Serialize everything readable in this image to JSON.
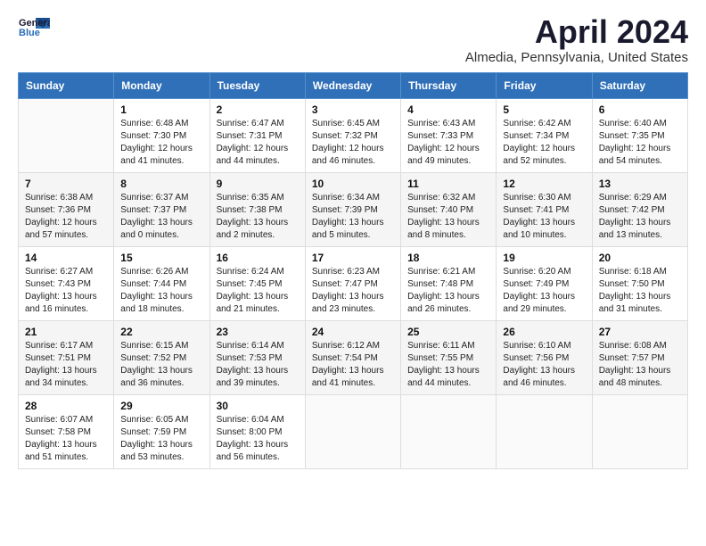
{
  "header": {
    "logo_line1": "General",
    "logo_line2": "Blue",
    "month_title": "April 2024",
    "location": "Almedia, Pennsylvania, United States"
  },
  "weekdays": [
    "Sunday",
    "Monday",
    "Tuesday",
    "Wednesday",
    "Thursday",
    "Friday",
    "Saturday"
  ],
  "weeks": [
    [
      {
        "day": "",
        "info": ""
      },
      {
        "day": "1",
        "info": "Sunrise: 6:48 AM\nSunset: 7:30 PM\nDaylight: 12 hours\nand 41 minutes."
      },
      {
        "day": "2",
        "info": "Sunrise: 6:47 AM\nSunset: 7:31 PM\nDaylight: 12 hours\nand 44 minutes."
      },
      {
        "day": "3",
        "info": "Sunrise: 6:45 AM\nSunset: 7:32 PM\nDaylight: 12 hours\nand 46 minutes."
      },
      {
        "day": "4",
        "info": "Sunrise: 6:43 AM\nSunset: 7:33 PM\nDaylight: 12 hours\nand 49 minutes."
      },
      {
        "day": "5",
        "info": "Sunrise: 6:42 AM\nSunset: 7:34 PM\nDaylight: 12 hours\nand 52 minutes."
      },
      {
        "day": "6",
        "info": "Sunrise: 6:40 AM\nSunset: 7:35 PM\nDaylight: 12 hours\nand 54 minutes."
      }
    ],
    [
      {
        "day": "7",
        "info": "Sunrise: 6:38 AM\nSunset: 7:36 PM\nDaylight: 12 hours\nand 57 minutes."
      },
      {
        "day": "8",
        "info": "Sunrise: 6:37 AM\nSunset: 7:37 PM\nDaylight: 13 hours\nand 0 minutes."
      },
      {
        "day": "9",
        "info": "Sunrise: 6:35 AM\nSunset: 7:38 PM\nDaylight: 13 hours\nand 2 minutes."
      },
      {
        "day": "10",
        "info": "Sunrise: 6:34 AM\nSunset: 7:39 PM\nDaylight: 13 hours\nand 5 minutes."
      },
      {
        "day": "11",
        "info": "Sunrise: 6:32 AM\nSunset: 7:40 PM\nDaylight: 13 hours\nand 8 minutes."
      },
      {
        "day": "12",
        "info": "Sunrise: 6:30 AM\nSunset: 7:41 PM\nDaylight: 13 hours\nand 10 minutes."
      },
      {
        "day": "13",
        "info": "Sunrise: 6:29 AM\nSunset: 7:42 PM\nDaylight: 13 hours\nand 13 minutes."
      }
    ],
    [
      {
        "day": "14",
        "info": "Sunrise: 6:27 AM\nSunset: 7:43 PM\nDaylight: 13 hours\nand 16 minutes."
      },
      {
        "day": "15",
        "info": "Sunrise: 6:26 AM\nSunset: 7:44 PM\nDaylight: 13 hours\nand 18 minutes."
      },
      {
        "day": "16",
        "info": "Sunrise: 6:24 AM\nSunset: 7:45 PM\nDaylight: 13 hours\nand 21 minutes."
      },
      {
        "day": "17",
        "info": "Sunrise: 6:23 AM\nSunset: 7:47 PM\nDaylight: 13 hours\nand 23 minutes."
      },
      {
        "day": "18",
        "info": "Sunrise: 6:21 AM\nSunset: 7:48 PM\nDaylight: 13 hours\nand 26 minutes."
      },
      {
        "day": "19",
        "info": "Sunrise: 6:20 AM\nSunset: 7:49 PM\nDaylight: 13 hours\nand 29 minutes."
      },
      {
        "day": "20",
        "info": "Sunrise: 6:18 AM\nSunset: 7:50 PM\nDaylight: 13 hours\nand 31 minutes."
      }
    ],
    [
      {
        "day": "21",
        "info": "Sunrise: 6:17 AM\nSunset: 7:51 PM\nDaylight: 13 hours\nand 34 minutes."
      },
      {
        "day": "22",
        "info": "Sunrise: 6:15 AM\nSunset: 7:52 PM\nDaylight: 13 hours\nand 36 minutes."
      },
      {
        "day": "23",
        "info": "Sunrise: 6:14 AM\nSunset: 7:53 PM\nDaylight: 13 hours\nand 39 minutes."
      },
      {
        "day": "24",
        "info": "Sunrise: 6:12 AM\nSunset: 7:54 PM\nDaylight: 13 hours\nand 41 minutes."
      },
      {
        "day": "25",
        "info": "Sunrise: 6:11 AM\nSunset: 7:55 PM\nDaylight: 13 hours\nand 44 minutes."
      },
      {
        "day": "26",
        "info": "Sunrise: 6:10 AM\nSunset: 7:56 PM\nDaylight: 13 hours\nand 46 minutes."
      },
      {
        "day": "27",
        "info": "Sunrise: 6:08 AM\nSunset: 7:57 PM\nDaylight: 13 hours\nand 48 minutes."
      }
    ],
    [
      {
        "day": "28",
        "info": "Sunrise: 6:07 AM\nSunset: 7:58 PM\nDaylight: 13 hours\nand 51 minutes."
      },
      {
        "day": "29",
        "info": "Sunrise: 6:05 AM\nSunset: 7:59 PM\nDaylight: 13 hours\nand 53 minutes."
      },
      {
        "day": "30",
        "info": "Sunrise: 6:04 AM\nSunset: 8:00 PM\nDaylight: 13 hours\nand 56 minutes."
      },
      {
        "day": "",
        "info": ""
      },
      {
        "day": "",
        "info": ""
      },
      {
        "day": "",
        "info": ""
      },
      {
        "day": "",
        "info": ""
      }
    ]
  ]
}
